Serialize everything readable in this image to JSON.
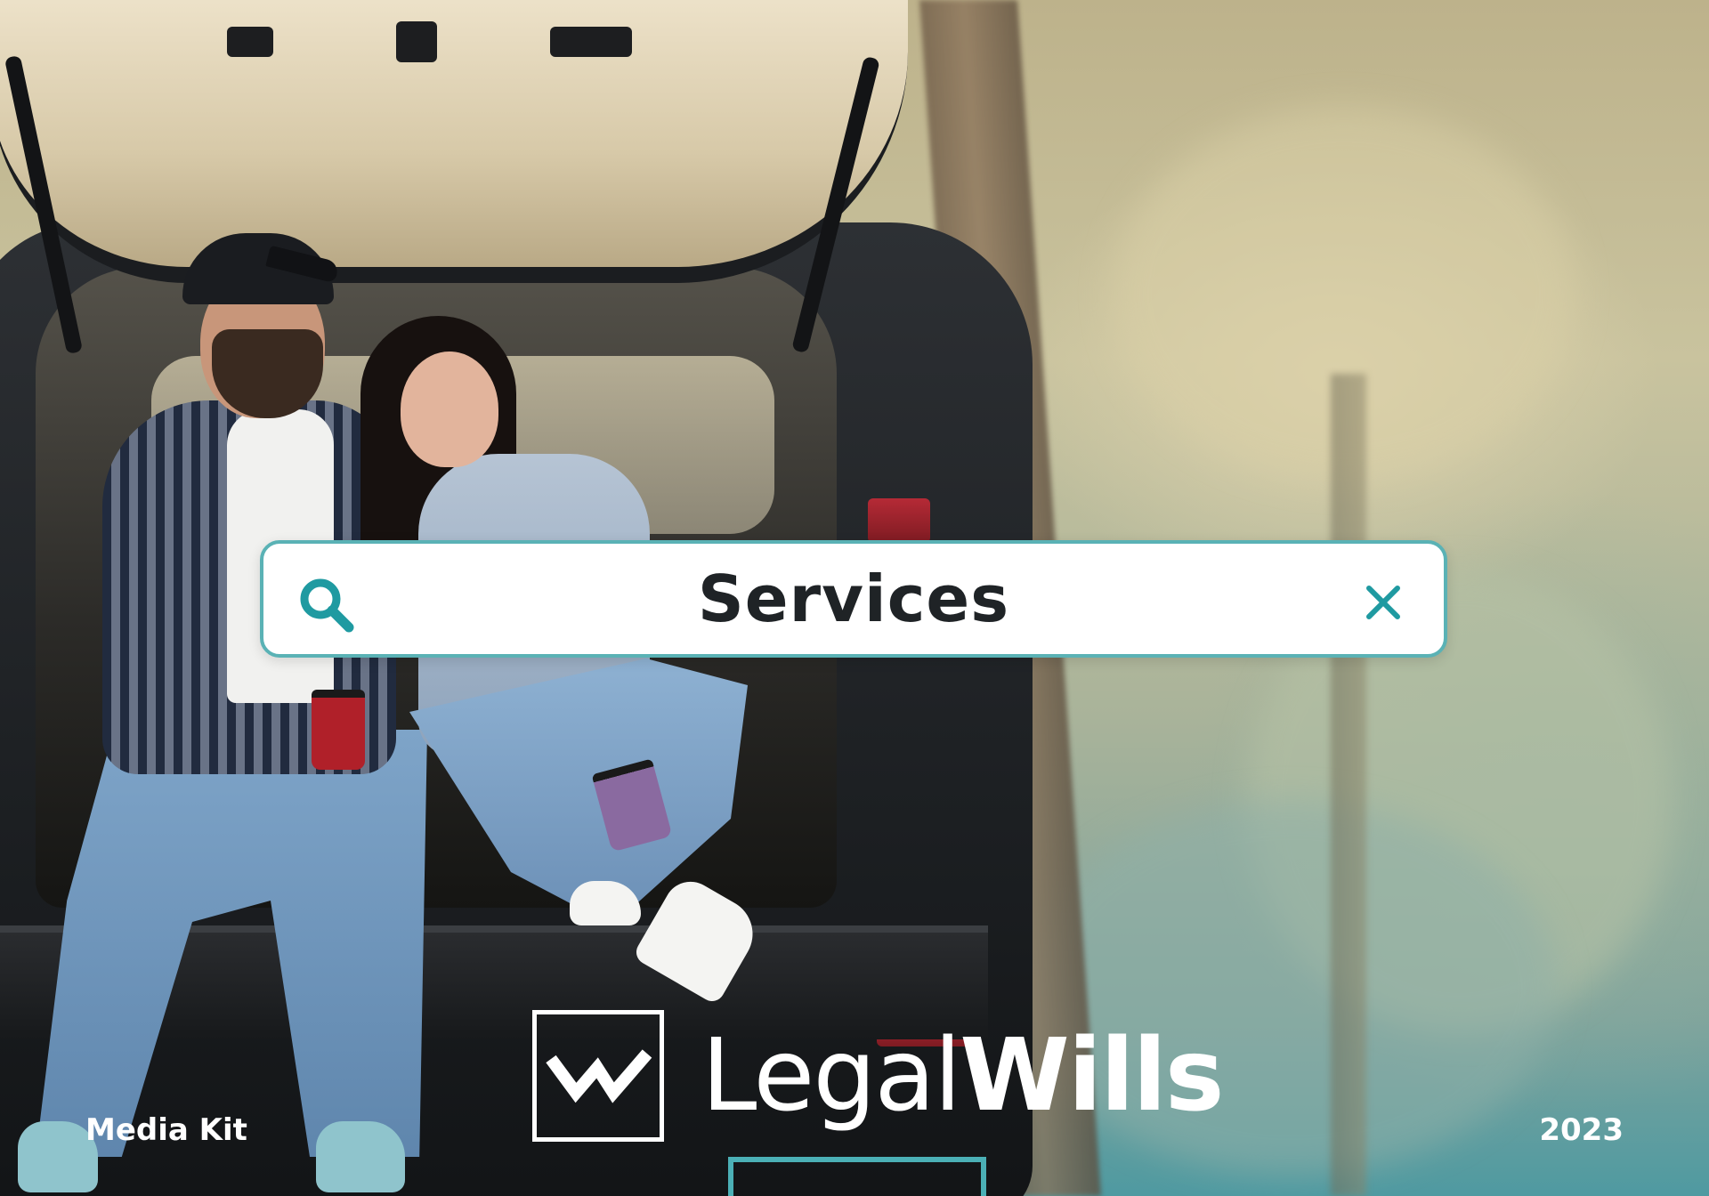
{
  "search": {
    "query": "Services"
  },
  "brand": {
    "name_light": "Legal",
    "name_bold": "Wills"
  },
  "footer": {
    "left_label": "Media Kit",
    "right_label": "2023"
  },
  "colors": {
    "accent": "#1f9aa1",
    "search_border": "#5ab2b5",
    "text_dark": "#1f2326",
    "logo": "#ffffff"
  },
  "icons": {
    "search": "search-icon",
    "clear": "close-icon",
    "logo_mark": "checkmark-logo-icon"
  }
}
